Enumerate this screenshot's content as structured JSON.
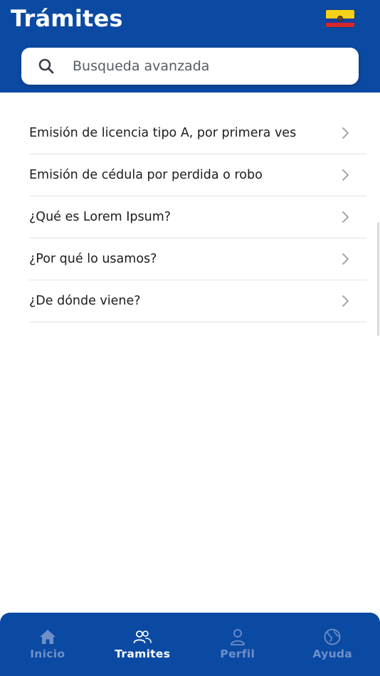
{
  "header": {
    "title": "Trámites",
    "flag_icon": "ecuador-flag-icon",
    "flag_colors": [
      "#f7d117",
      "#1a3fa0",
      "#d62828"
    ]
  },
  "search": {
    "icon": "search-icon",
    "placeholder": "Busqueda avanzada",
    "value": ""
  },
  "procedures": {
    "items": [
      {
        "label": "Emisión de licencia tipo A, por primera ves"
      },
      {
        "label": "Emisión de cédula por perdida o robo"
      },
      {
        "label": "¿Qué es Lorem Ipsum?"
      },
      {
        "label": "¿Por qué lo usamos?"
      },
      {
        "label": "¿De dónde viene?"
      }
    ],
    "item_icon": "chevron-right-icon"
  },
  "bottom_nav": {
    "items": [
      {
        "label": "Inicio",
        "icon": "home-icon",
        "active": false
      },
      {
        "label": "Tramites",
        "icon": "users-icon",
        "active": true
      },
      {
        "label": "Perfil",
        "icon": "user-icon",
        "active": false
      },
      {
        "label": "Ayuda",
        "icon": "globe-icon",
        "active": false
      }
    ]
  },
  "colors": {
    "primary": "#0b4aa3",
    "nav_inactive": "#6f8fc7",
    "nav_active": "#ffffff",
    "divider": "#e3e3e3"
  }
}
